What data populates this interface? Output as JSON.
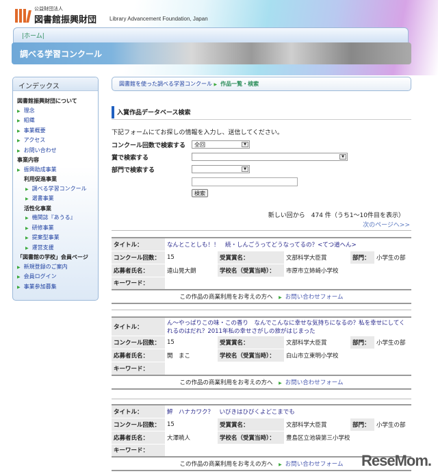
{
  "header": {
    "org_type": "公益財団法人",
    "org_name": "図書館振興財団",
    "org_name_en": "Library Advancement Foundation, Japan",
    "nav_home": "|ホーム|",
    "banner_title": "調べる学習コンクール"
  },
  "sidebar": {
    "title": "インデックス",
    "items": [
      {
        "type": "hd",
        "label": "図書館振興財団について"
      },
      {
        "type": "a",
        "label": "理念"
      },
      {
        "type": "a",
        "label": "組織"
      },
      {
        "type": "a",
        "label": "事業概要"
      },
      {
        "type": "a",
        "label": "アクセス"
      },
      {
        "type": "a",
        "label": "お問い合わせ"
      },
      {
        "type": "hd",
        "label": "事業内容"
      },
      {
        "type": "a",
        "label": "振興助成事業"
      },
      {
        "type": "sub",
        "label": "利用促進事業"
      },
      {
        "type": "a2",
        "label": "調べる学習コンクール"
      },
      {
        "type": "a2",
        "label": "選書事業"
      },
      {
        "type": "sub",
        "label": "活性化事業"
      },
      {
        "type": "a2",
        "label": "機関誌『あうる』"
      },
      {
        "type": "a2",
        "label": "研修事業"
      },
      {
        "type": "a2",
        "label": "提案型事業"
      },
      {
        "type": "a2",
        "label": "運営支援"
      },
      {
        "type": "hd",
        "label": "「図書館の学校」会員ページ"
      },
      {
        "type": "a",
        "label": "新規登録のご案内"
      },
      {
        "type": "a",
        "label": "会員ログイン"
      },
      {
        "type": "a",
        "label": "事業参加募集"
      }
    ]
  },
  "breadcrumb": {
    "parent": "図書館を使った調べる学習コンクール",
    "current": "作品一覧・検索"
  },
  "section_title": "入賞作品データベース検索",
  "form": {
    "intro": "下記フォームにてお探しの情報を入力し、送信してください。",
    "contest_label": "コンクール回数で検索する",
    "contest_value": "全回",
    "award_label": "賞で検索する",
    "award_value": "",
    "division_label": "部門で検索する",
    "division_value": "",
    "keyword_value": "",
    "search_button": "検索"
  },
  "results": {
    "summary": "新しい回から　474 件（うち1～10件目を表示）",
    "next": "次のページへ>>"
  },
  "labels": {
    "title": "タイトル：",
    "round": "コンクール回数：",
    "award": "受賞賞名：",
    "division": "部門：",
    "name": "応募者氏名：",
    "school": "学校名（受賞当時）：",
    "keyword": "キーワード：",
    "commercial": "この作品の商業利用をお考えの方へ",
    "contact": "お問い合わせフォーム"
  },
  "records": [
    {
      "title": "なんとことしも！！　続・しんごうってどうなってるの？<てつ道へん>",
      "round": "15",
      "award": "文部科学大臣賞",
      "division": "小学生の部",
      "name": "遠山晃大朗",
      "school": "市原市立姉崎小学校",
      "keyword": ""
    },
    {
      "title": "ん～やっぱりこの味・この香り　なんでこんなに幸せな気持ちになるの？私を幸せにしてくれるのはだれ？2011年私の幸せさがしの旅がはじまった",
      "round": "15",
      "award": "文部科学大臣賞",
      "division": "小学生の部",
      "name": "開　まこ",
      "school": "白山市立東明小学校",
      "keyword": ""
    },
    {
      "title": "鮃　ハナカワク？　いびきはひびくよどこまでも",
      "round": "15",
      "award": "文部科学大臣賞",
      "division": "小学生の部",
      "name": "大澤暁人",
      "school": "豊島区立池袋第三小学校",
      "keyword": ""
    }
  ],
  "watermark": "ReseMom"
}
